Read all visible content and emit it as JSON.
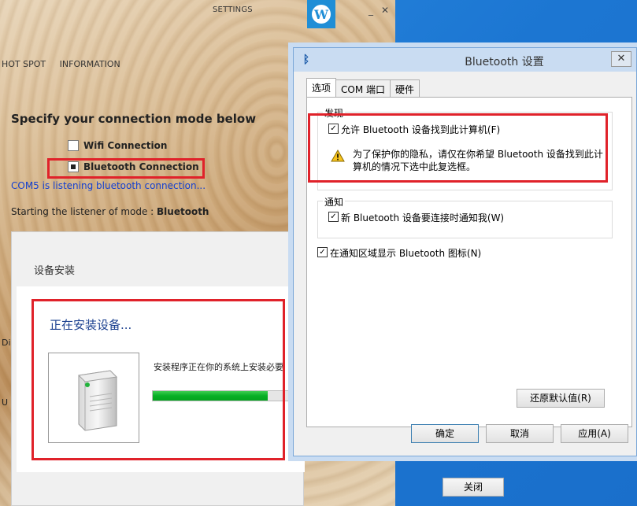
{
  "app": {
    "title": "SETTINGS",
    "nav": [
      "HOT SPOT",
      "INFORMATION"
    ],
    "mode_heading": "Specify your connection mode below",
    "modes": [
      {
        "label": "Wifi Connection",
        "selected": false
      },
      {
        "label": "Bluetooth Connection",
        "selected": true
      }
    ],
    "com_status": "COM5 is listening bluetooth connection...",
    "listener_prefix": "Starting the listener of mode : ",
    "listener_mode": "Bluetooth",
    "side_text_1": "Di",
    "side_text_2": "U",
    "colors": {
      "logo": "#1f8ed6",
      "link": "#1440d0",
      "highlight": "#e0222a"
    }
  },
  "install_dialog": {
    "title": "设备安装",
    "heading": "正在安装设备...",
    "message": "安装程序正在你的系统上安装必要",
    "progress": 0.76,
    "close_label": "关闭"
  },
  "bt_dialog": {
    "title": "Bluetooth 设置",
    "close": "✕",
    "tabs": [
      "选项",
      "COM 端口",
      "硬件"
    ],
    "discover_label": "发现",
    "allow_label": "允许 Bluetooth 设备找到此计算机(F)",
    "allow_checked": true,
    "warning": "为了保护你的隐私，请仅在你希望 Bluetooth 设备找到此计算机的情况下选中此复选框。",
    "notify_group_label": "通知",
    "notify_label": "新 Bluetooth 设备要连接时通知我(W)",
    "notify_checked": true,
    "show_icon_label": "在通知区域显示 Bluetooth 图标(N)",
    "show_icon_checked": true,
    "restore_label": "还原默认值(R)",
    "ok_label": "确定",
    "cancel_label": "取消",
    "apply_label": "应用(A)"
  }
}
